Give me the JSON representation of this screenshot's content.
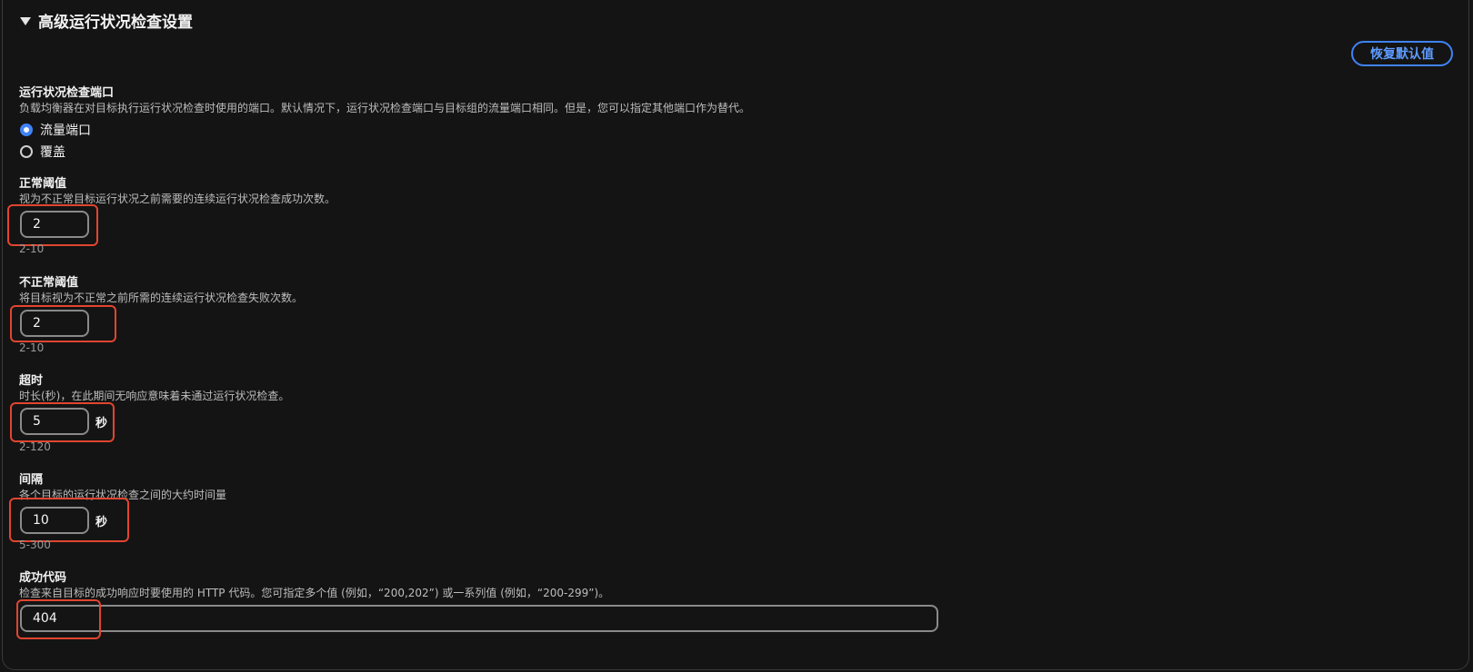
{
  "section": {
    "title": "高级运行状况检查设置"
  },
  "reset_button": "恢复默认值",
  "port": {
    "label": "运行状况检查端口",
    "description": "负载均衡器在对目标执行运行状况检查时使用的端口。默认情况下，运行状况检查端口与目标组的流量端口相同。但是，您可以指定其他端口作为替代。",
    "options": [
      {
        "label": "流量端口",
        "selected": true
      },
      {
        "label": "覆盖",
        "selected": false
      }
    ]
  },
  "healthy_threshold": {
    "label": "正常阈值",
    "description": "视为不正常目标运行状况之前需要的连续运行状况检查成功次数。",
    "value": "2",
    "hint": "2-10"
  },
  "unhealthy_threshold": {
    "label": "不正常阈值",
    "description": "将目标视为不正常之前所需的连续运行状况检查失败次数。",
    "value": "2",
    "hint": "2-10"
  },
  "timeout": {
    "label": "超时",
    "description": "时长(秒)，在此期间无响应意味着未通过运行状况检查。",
    "value": "5",
    "unit": "秒",
    "hint": "2-120"
  },
  "interval": {
    "label": "间隔",
    "description": "各个目标的运行状况检查之间的大约时间量",
    "value": "10",
    "unit": "秒",
    "hint": "5-300"
  },
  "success_codes": {
    "label": "成功代码",
    "description": "检查来自目标的成功响应时要使用的 HTTP 代码。您可指定多个值 (例如，“200,202”) 或一系列值 (例如，“200-299”)。",
    "value": "404"
  },
  "colors": {
    "accent": "#3f83f7",
    "highlight": "#e2452f",
    "background": "#141414"
  }
}
